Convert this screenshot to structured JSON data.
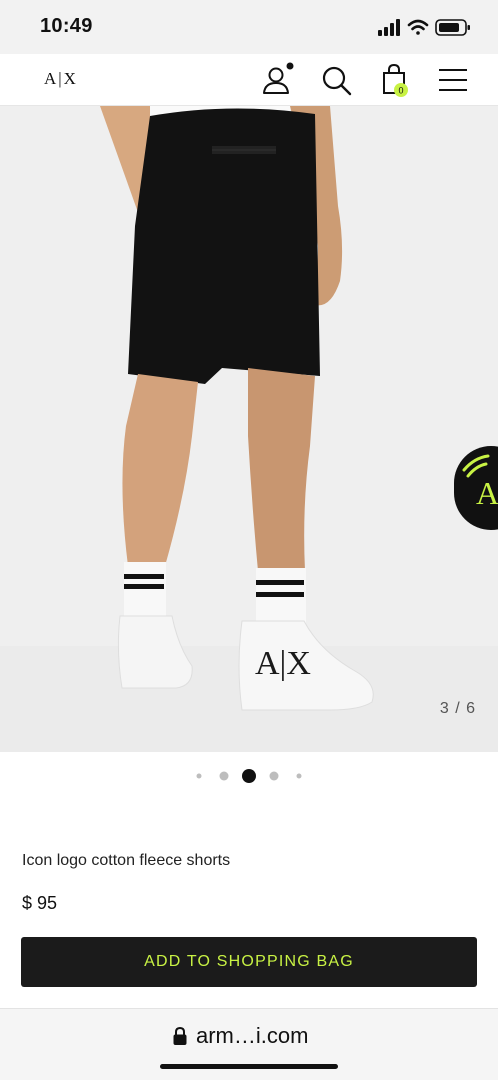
{
  "status_bar": {
    "time": "10:49"
  },
  "header": {
    "logo": "A|X",
    "cart_count": "0"
  },
  "gallery": {
    "counter": "3 / 6",
    "badge_letter": "A",
    "sock_logo": "A|X"
  },
  "carousel": {
    "total": 5,
    "active": 3
  },
  "product": {
    "name": "Icon logo cotton fleece shorts",
    "price": "$ 95"
  },
  "actions": {
    "add_to_bag": "ADD TO SHOPPING BAG"
  },
  "browser": {
    "url": "arm…i.com"
  },
  "colors": {
    "accent": "#c8f244",
    "button_bg": "#1b1b1b",
    "gallery_bg": "#efefef"
  }
}
